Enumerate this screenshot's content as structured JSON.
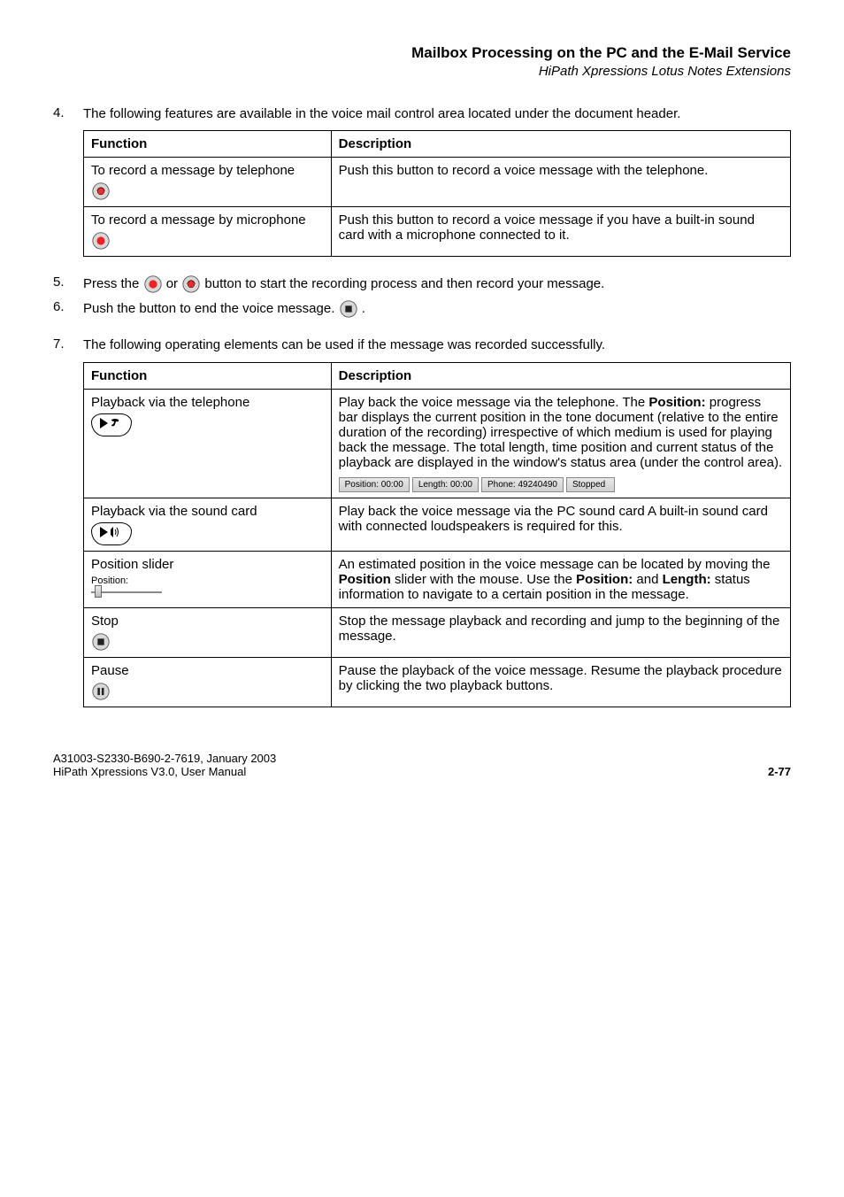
{
  "header": {
    "title": "Mailbox Processing on the PC and the E-Mail Service",
    "subtitle": "HiPath Xpressions Lotus Notes Extensions"
  },
  "step4": {
    "num": "4.",
    "text": "The following features are available in the voice mail control area located under the document header.",
    "tableHead": {
      "col1": "Function",
      "col2": "Description"
    },
    "rows": [
      {
        "func": "To record a message by telephone",
        "desc": "Push this button to record a voice message with the telephone."
      },
      {
        "func": "To record a message by microphone",
        "desc": "Push this button to record a voice message if you have a built-in sound card with a microphone connected to it."
      }
    ]
  },
  "step5": {
    "num": "5.",
    "pre": "Press the ",
    "post": " button to start the recording process and then record your message.",
    "or": " or "
  },
  "step6": {
    "num": "6.",
    "pre": "Push the button to end the voice message. "
  },
  "step7": {
    "num": "7.",
    "text": "The following operating elements can be used if the message was recorded successfully.",
    "tableHead": {
      "col1": "Function",
      "col2": "Description"
    },
    "rows": {
      "playTel": {
        "func": "Playback via the telephone",
        "descParts": {
          "p1": "Play back the voice message via the telephone. The ",
          "bold1": "Position:",
          "p2": " progress bar displays the current position in the tone document (relative to the entire duration of the recording) irrespective of which medium is used for playing back the message. The total length, time position and current status of the playback are displayed in the window's status area (under the control area)."
        },
        "status": {
          "a": "Position: 00:00",
          "b": "Length: 00:00",
          "c": "Phone: 49240490",
          "d": "Stopped"
        }
      },
      "playSound": {
        "func": "Playback via the sound card",
        "desc": "Play back the voice message via the PC sound card A built-in sound card with connected loudspeakers is required for this."
      },
      "posSlider": {
        "func": "Position slider",
        "label": "Position:",
        "descParts": {
          "p1": "An estimated position in the voice message can be located by moving the ",
          "bold1": "Position",
          "p2": " slider with the mouse. Use the ",
          "bold2": "Position:",
          "p3": " and ",
          "bold3": "Length:",
          "p4": " status information to navigate to a certain position in the message."
        }
      },
      "stop": {
        "func": "Stop",
        "desc": "Stop the message playback and recording and jump to the beginning of the message."
      },
      "pause": {
        "func": "Pause",
        "desc": "Pause the playback of the voice message. Resume the playback procedure by clicking the two playback buttons."
      }
    }
  },
  "footer": {
    "left1": "A31003-S2330-B690-2-7619, January 2003",
    "left2": "HiPath Xpressions V3.0, User Manual",
    "right": "2-77"
  }
}
